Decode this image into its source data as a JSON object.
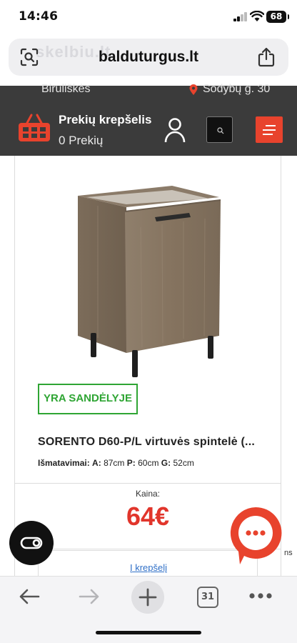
{
  "status_bar": {
    "time": "14:46",
    "battery": "68"
  },
  "browser": {
    "url": "baldutur­gus.lt",
    "watermark": "skelbiu.lt"
  },
  "site_header": {
    "location_left": "Biruliškės",
    "location_right": "Sodybų g. 30",
    "cart_title": "Prekių krepšelis",
    "cart_count": "0 Prekių",
    "brand_color": "#e8432d"
  },
  "product": {
    "stock_status": "YRA SANDĖLYJE",
    "title": "SORENTO D60-P/L virtuvės spintelė (...",
    "dims_label": "Išmatavimai:",
    "dims": [
      {
        "key": "A:",
        "value": "87cm"
      },
      {
        "key": "P:",
        "value": "60cm"
      },
      {
        "key": "G:",
        "value": "52cm"
      }
    ],
    "price_label": "Kaina:",
    "price": "64€",
    "add_to_cart": "Į krepšelį"
  },
  "edge_text": "ns",
  "toolbar": {
    "tabs_count": "31"
  }
}
